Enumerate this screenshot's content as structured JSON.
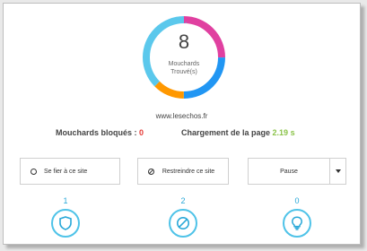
{
  "tracker": {
    "count": "8",
    "label_line1": "Mouchards",
    "label_line2": "Trouvé(s)"
  },
  "donut_segments": [
    {
      "color": "#e040a0",
      "fraction": 0.25
    },
    {
      "color": "#2196f3",
      "fraction": 0.25
    },
    {
      "color": "#ff9800",
      "fraction": 0.125
    },
    {
      "color": "#5bc8ec",
      "fraction": 0.375
    }
  ],
  "site": {
    "domain": "www.lesechos.fr"
  },
  "stats": {
    "blocked_label": "Mouchards bloqués :",
    "blocked_value": "0",
    "load_label": "Chargement de la page",
    "load_value": "2.19 s"
  },
  "actions": {
    "trust_label": "Se fier à ce site",
    "restrict_label": "Restreindre ce site",
    "pause_label": "Pause"
  },
  "categories": [
    {
      "count": "1",
      "icon": "shield-icon"
    },
    {
      "count": "2",
      "icon": "block-icon"
    },
    {
      "count": "0",
      "icon": "lightbulb-icon"
    }
  ],
  "colors": {
    "accent": "#29a8d8",
    "blocked": "#e53935",
    "load": "#8bc34a"
  }
}
